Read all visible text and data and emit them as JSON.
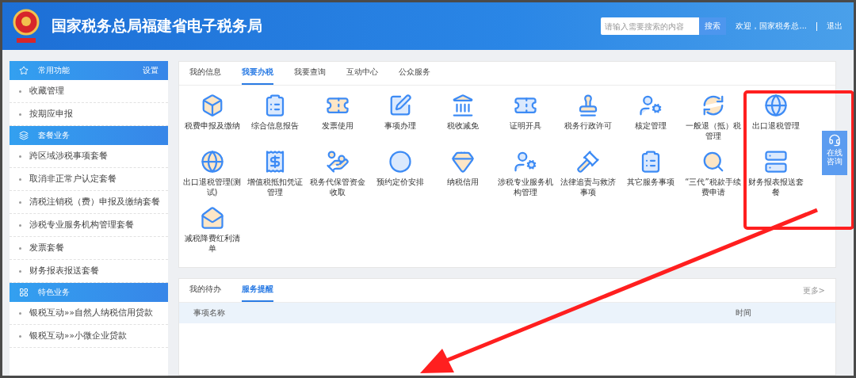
{
  "header": {
    "title": "国家税务总局福建省电子税务局",
    "search": {
      "placeholder": "请输入需要搜索的内容",
      "button": "搜索"
    },
    "welcome": "欢迎，国家税务总...",
    "logout": "退出"
  },
  "sidebar": {
    "sections": [
      {
        "title": "常用功能",
        "action": "设置",
        "items": [
          "收藏管理",
          "按期应申报"
        ]
      },
      {
        "title": "套餐业务",
        "items": [
          "跨区域涉税事项套餐",
          "取消非正常户认定套餐",
          "清税注销税（费）申报及缴纳套餐",
          "涉税专业服务机构管理套餐",
          "发票套餐",
          "财务报表报送套餐"
        ]
      },
      {
        "title": "特色业务",
        "items": [
          "银税互动»»自然人纳税信用贷款",
          "银税互动»»小微企业贷款"
        ]
      }
    ]
  },
  "main_tabs": [
    {
      "label": "我的信息",
      "selected": false
    },
    {
      "label": "我要办税",
      "selected": true
    },
    {
      "label": "我要查询",
      "selected": false
    },
    {
      "label": "互动中心",
      "selected": false
    },
    {
      "label": "公众服务",
      "selected": false
    }
  ],
  "services": [
    "税费申报及缴纳",
    "综合信息报告",
    "发票使用",
    "事项办理",
    "税收减免",
    "证明开具",
    "税务行政许可",
    "核定管理",
    "一般退（抵）税管理",
    "出口退税管理",
    "出口退税管理(测试)",
    "增值税抵扣凭证管理",
    "税务代保管资金收取",
    "预约定价安排",
    "纳税信用",
    "涉税专业服务机构管理",
    "法律追责与救济事项",
    "其它服务事项",
    "“三代”税款手续费申请",
    "财务报表报送套餐",
    "减税降费红利清单"
  ],
  "reminder_panel": {
    "tabs": [
      {
        "label": "我的待办",
        "selected": false
      },
      {
        "label": "服务提醒",
        "selected": true
      }
    ],
    "more": "更多>",
    "columns": [
      "事项名称",
      "时间"
    ]
  },
  "float_button": "在线咨询"
}
